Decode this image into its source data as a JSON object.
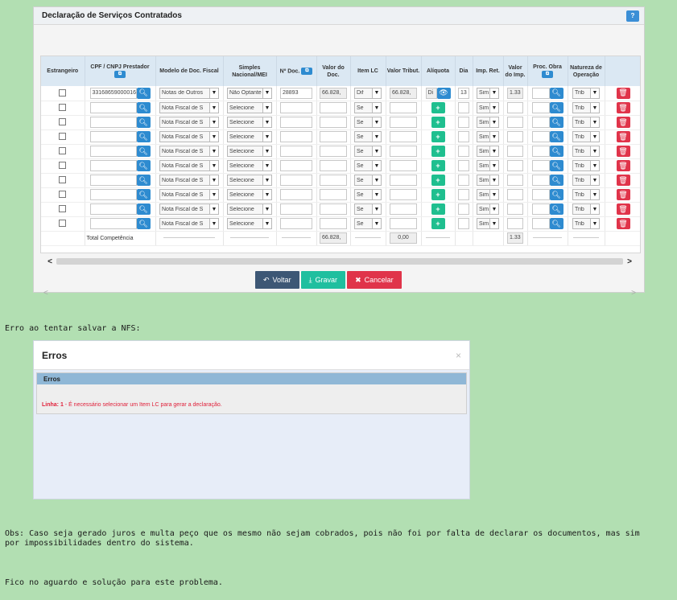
{
  "panel": {
    "title": "Declaração de Serviços Contratados",
    "help": "?"
  },
  "table": {
    "headers": {
      "estrangeiro": "Estrangeiro",
      "cpf_cnpj": "CPF / CNPJ Prestador",
      "modelo": "Modelo de Doc. Fiscal",
      "simples": "Simples Nacional/MEI",
      "num_doc": "Nº Doc.",
      "valor_doc": "Valor do Doc.",
      "item_lc": "Item LC",
      "valor_trib": "Valor Tribut.",
      "aliquota": "Alíquota",
      "dia": "Dia",
      "imp_ret": "Imp. Ret.",
      "valor_imp": "Valor do Imp.",
      "proc_obra": "Proc. Obra",
      "natureza": "Natureza de Operação"
    },
    "row1": {
      "cpf_cnpj": "33168659000016",
      "modelo": "Notas de Outros",
      "simples": "Não Optante",
      "num_doc": "28893",
      "valor_doc": "66.828,",
      "item_lc": "Dif",
      "valor_trib": "66.828,",
      "aliquota": "Di",
      "dia": "13",
      "imp_ret": "Sim",
      "valor_imp": "1.33",
      "natureza": "Trib"
    },
    "empty_row": {
      "modelo": "Nota Fiscal de S",
      "simples": "Selecione",
      "item_lc": "Se",
      "imp_ret": "Sim",
      "natureza": "Trib"
    },
    "totals": {
      "label": "Total Competência",
      "valor_doc": "66.828,",
      "valor_trib": "0,00",
      "valor_imp": "1.33"
    }
  },
  "buttons": {
    "voltar": "Voltar",
    "gravar": "Gravar",
    "cancelar": "Cancelar"
  },
  "text": {
    "erro_intro": "Erro ao tentar salvar a NFS:",
    "obs": "Obs: Caso seja gerado juros e multa peço que os mesmo não sejam cobrados, pois não foi por falta de declarar os documentos, mas sim por impossibilidades dentro do sistema.",
    "fico": "Fico no aguardo e solução para este problema."
  },
  "modal": {
    "title": "Erros",
    "close": "×",
    "panel_title": "Erros",
    "line_label": "Linha: 1",
    "message": " - É necessário selecionar um Item LC para gerar a declaração."
  },
  "colors": {
    "background": "#b2dfb2",
    "blue": "#2e8bd0",
    "green": "#1fbf8f",
    "red": "#e0344a",
    "error_text": "#e0203a"
  },
  "icons": {
    "search": "search-icon",
    "plus": "plus-icon",
    "eye": "eye-icon",
    "trash": "trash-icon",
    "copy": "copy-icon"
  }
}
